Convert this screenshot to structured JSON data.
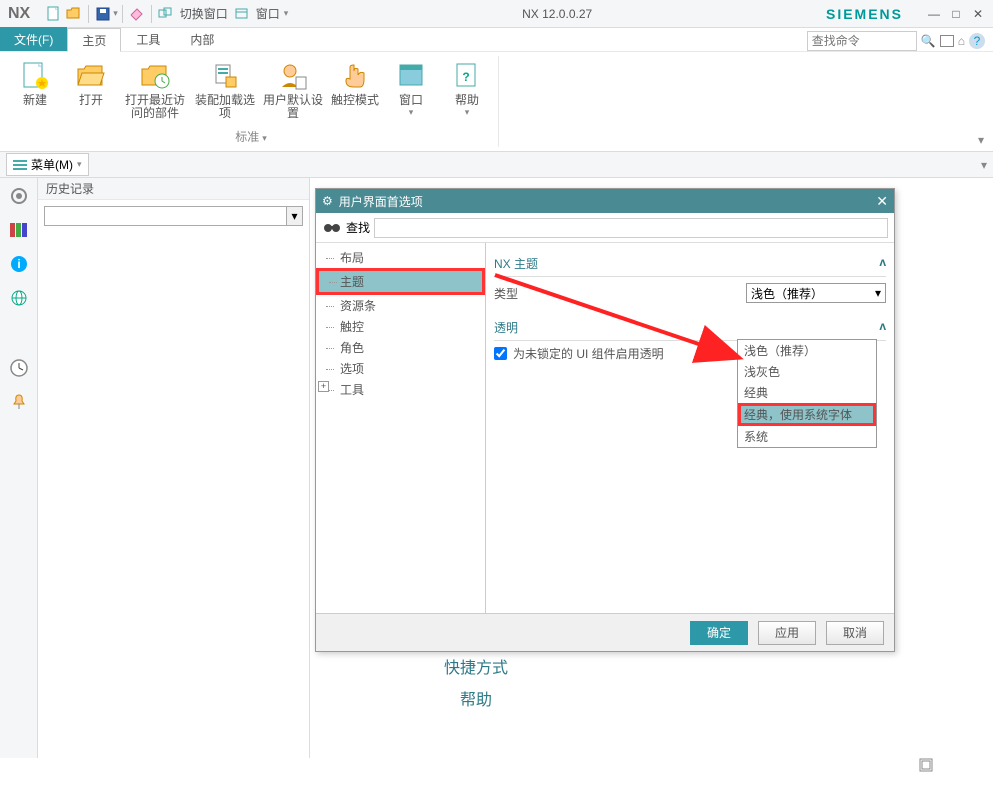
{
  "title": {
    "app": "NX",
    "version": "NX 12.0.0.27",
    "brand": "SIEMENS"
  },
  "toolbar": {
    "switch_window": "切换窗口",
    "window": "窗口"
  },
  "menu": {
    "file": "文件(F)",
    "home": "主页",
    "tools": "工具",
    "internal": "内部",
    "search_placeholder": "查找命令"
  },
  "ribbon": {
    "items": [
      {
        "label": "新建"
      },
      {
        "label": "打开"
      },
      {
        "label": "打开最近访问的部件"
      },
      {
        "label": "装配加载选项"
      },
      {
        "label": "用户默认设置"
      },
      {
        "label": "触控模式"
      },
      {
        "label": "窗口"
      },
      {
        "label": "帮助"
      }
    ],
    "group": "标准"
  },
  "menubar2": {
    "menu": "菜单(M)"
  },
  "history": {
    "title": "历史记录"
  },
  "dialog": {
    "title": "用户界面首选项",
    "search_label": "查找",
    "tree": [
      {
        "label": "布局"
      },
      {
        "label": "主题",
        "selected": true
      },
      {
        "label": "资源条"
      },
      {
        "label": "触控"
      },
      {
        "label": "角色"
      },
      {
        "label": "选项"
      },
      {
        "label": "工具",
        "expandable": true
      }
    ],
    "section1": "NX 主题",
    "type_label": "类型",
    "type_value": "浅色（推荐）",
    "dropdown": [
      "浅色（推荐）",
      "浅灰色",
      "经典",
      "经典，使用系统字体",
      "系统"
    ],
    "section2": "透明",
    "checkbox_label": "为未锁定的 UI 组件启用透明",
    "ok": "确定",
    "apply": "应用",
    "cancel": "取消"
  },
  "bottom": {
    "shortcut": "快捷方式",
    "help": "帮助"
  }
}
